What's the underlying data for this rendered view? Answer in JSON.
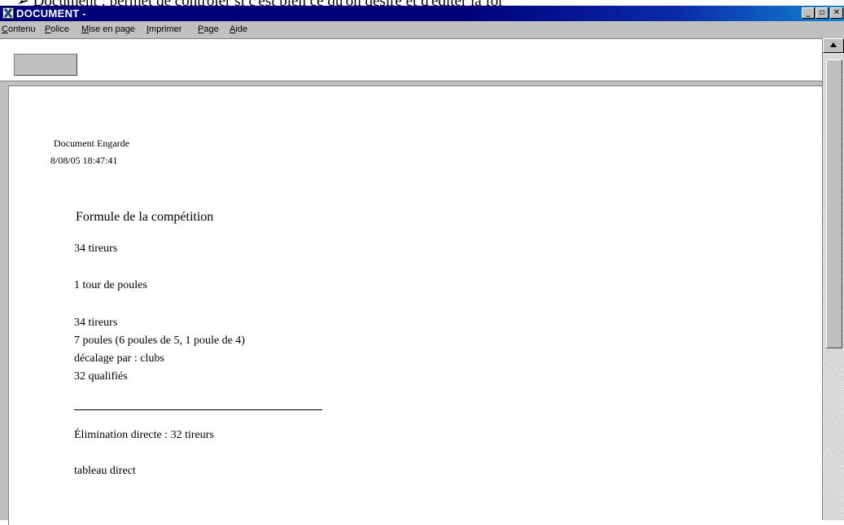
{
  "caption": "➢ Document : permet de contrôler si c'est bien ce qu'on désire et d'éditer la for",
  "window": {
    "title": "DOCUMENT -",
    "icon": "x-app-icon",
    "controls": {
      "minimize": "_",
      "restore": "▫",
      "close": "✕"
    }
  },
  "menu": {
    "items": [
      {
        "label": "Contenu",
        "accel": "C"
      },
      {
        "label": "Police",
        "accel": "P"
      },
      {
        "label": "Mise en page",
        "accel": "M"
      },
      {
        "label": "Imprimer",
        "accel": "I"
      },
      {
        "label": "Page",
        "accel": "P"
      },
      {
        "label": "Aide",
        "accel": "A"
      }
    ]
  },
  "document": {
    "header_title": "Document Engarde",
    "header_datetime": "8/08/05 18:47:41",
    "section_title": "Formule de la compétition",
    "lines": {
      "tireurs_total": "34 tireurs",
      "tour": "1 tour de poules",
      "tireurs_poules": "34 tireurs",
      "poules": "7 poules (6 poules de 5, 1 poule de 4)",
      "decalage": "décalage par : clubs",
      "qualifies": "32 qualifiés",
      "elimination": "Élimination directe : 32 tireurs",
      "tableau": "tableau direct"
    }
  },
  "colors": {
    "titlebar_start": "#00007b",
    "titlebar_end": "#1084d0",
    "chrome": "#c0c0c0",
    "page": "#ffffff"
  }
}
